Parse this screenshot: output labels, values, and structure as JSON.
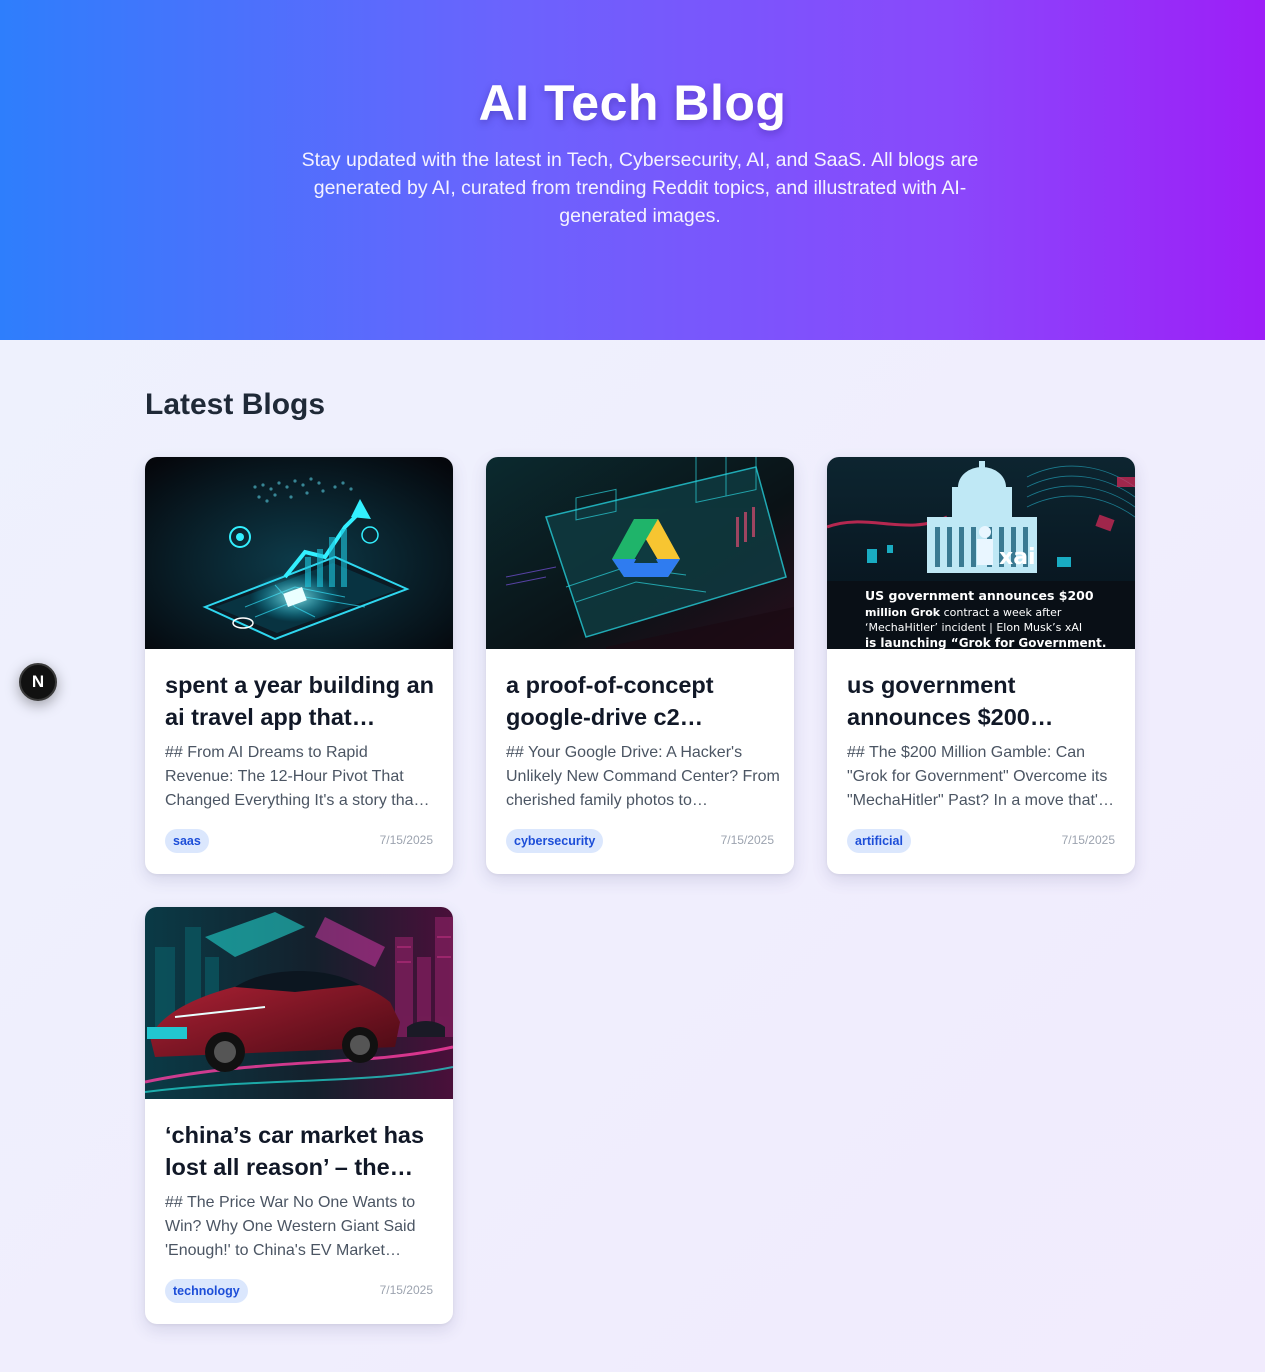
{
  "hero": {
    "title": "AI Tech Blog",
    "subtitle": "Stay updated with the latest in Tech, Cybersecurity, AI, and SaaS. All blogs are generated by AI, curated from trending Reddit topics, and illustrated with AI-generated images."
  },
  "section": {
    "title": "Latest Blogs"
  },
  "fab": {
    "label": "N"
  },
  "posts": [
    {
      "title": "spent a year building an ai travel app that…",
      "excerpt": "## From AI Dreams to Rapid Revenue: The 12-Hour Pivot That Changed Everything It's a story tha…",
      "tag": "saas",
      "date": "7/15/2025",
      "image": "smartphone-growth-chart-illustration"
    },
    {
      "title": "a proof-of-concept google-drive c2…",
      "excerpt": "## Your Google Drive: A Hacker's Unlikely New Command Center? From cherished family photos to…",
      "tag": "cybersecurity",
      "date": "7/15/2025",
      "image": "google-drive-dashboard-illustration"
    },
    {
      "title": "us government announces $200…",
      "excerpt": "## The $200 Million Gamble: Can \"Grok for Government\" Overcome its \"MechaHitler\" Past? In a move that'…",
      "tag": "artificial",
      "date": "7/15/2025",
      "image": "capitol-xai-illustration",
      "image_text": {
        "logo": "xai",
        "line1": "US government announces $200",
        "line2a": "million Grok",
        "line2b": " contract a week after",
        "line3": "‘MechaHitler’ incident | Elon Musk’s xAI",
        "line4": "is launching “Grok for Government."
      }
    },
    {
      "title": "‘china’s car market has lost all reason’ – the…",
      "excerpt": "## The Price War No One Wants to Win? Why One Western Giant Said 'Enough!' to China's EV Market…",
      "tag": "technology",
      "date": "7/15/2025",
      "image": "neon-electric-car-illustration"
    }
  ]
}
